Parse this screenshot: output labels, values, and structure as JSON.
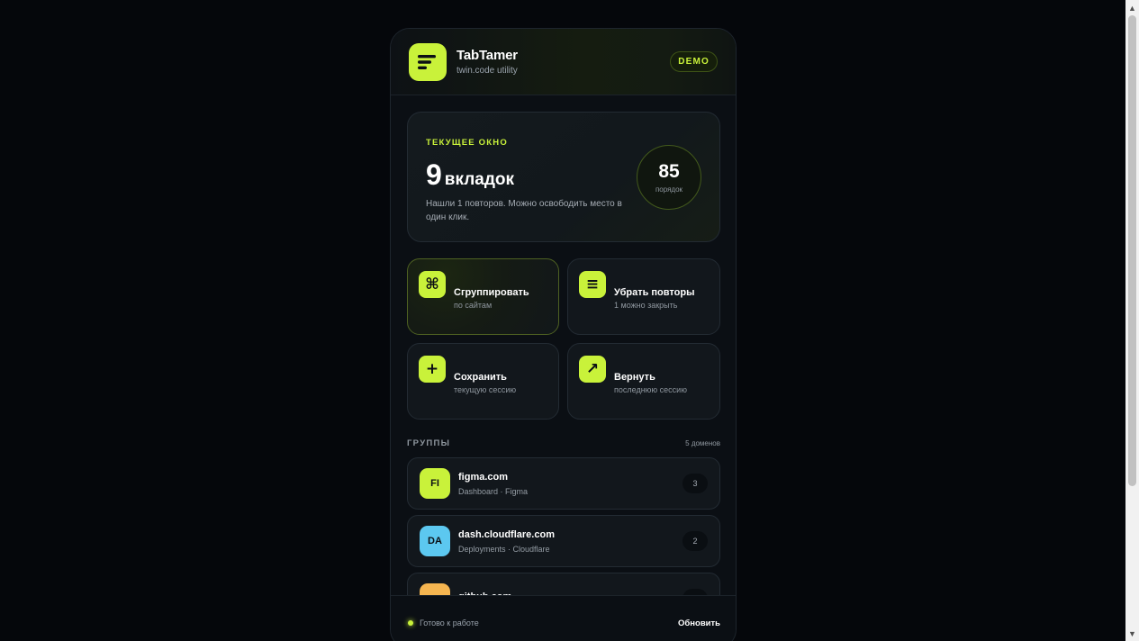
{
  "app": {
    "title": "TabTamer",
    "subtitle": "twin.code utility",
    "badge": "DEMO"
  },
  "hero": {
    "label": "ТЕКУЩЕЕ ОКНО",
    "tab_count": "9",
    "tab_unit": "вкладок",
    "description": "Нашли 1 повторов. Можно освободить место в один клик.",
    "score": "85",
    "score_label": "порядок"
  },
  "actions": [
    {
      "title": "Сгруппировать",
      "subtitle": "по сайтам",
      "icon": "command-icon",
      "glyph": "⌘"
    },
    {
      "title": "Убрать повторы",
      "subtitle": "1 можно закрыть",
      "icon": "list-icon",
      "glyph": "≡"
    },
    {
      "title": "Сохранить",
      "subtitle": "текущую сессию",
      "icon": "plus-icon",
      "glyph": "+"
    },
    {
      "title": "Вернуть",
      "subtitle": "последнюю сессию",
      "icon": "arrow-up-right-icon",
      "glyph": "↗"
    }
  ],
  "groups": {
    "title": "ГРУППЫ",
    "count_label": "5 доменов",
    "items": [
      {
        "initials": "FI",
        "domain": "figma.com",
        "desc": "Dashboard · Figma",
        "count": "3",
        "color": "#c9f23a"
      },
      {
        "initials": "DA",
        "domain": "dash.cloudflare.com",
        "desc": "Deployments · Cloudflare",
        "count": "2",
        "color": "#5cc8f0"
      },
      {
        "initials": "",
        "domain": "github.com",
        "desc": "",
        "count": "",
        "color": "#f5b550"
      }
    ]
  },
  "footer": {
    "status": "Готово к работе",
    "refresh_label": "Обновить"
  },
  "colors": {
    "accent": "#c9f23a",
    "background": "#05070b",
    "panel": "#0b0f14"
  }
}
